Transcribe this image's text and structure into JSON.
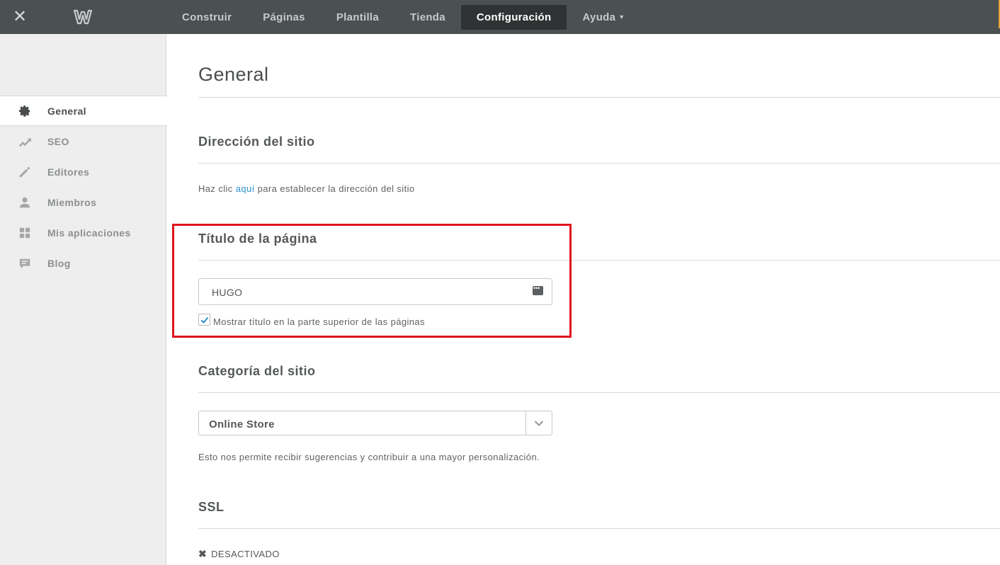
{
  "topbar": {
    "close_icon": "close-icon",
    "logo_icon": "weebly-logo-icon",
    "nav": [
      {
        "label": "Construir",
        "active": false
      },
      {
        "label": "Páginas",
        "active": false
      },
      {
        "label": "Plantilla",
        "active": false
      },
      {
        "label": "Tienda",
        "active": false
      },
      {
        "label": "Configuración",
        "active": true
      },
      {
        "label": "Ayuda",
        "active": false,
        "has_caret": true
      }
    ]
  },
  "sidebar": {
    "items": [
      {
        "label": "General",
        "icon": "gear-icon",
        "active": true
      },
      {
        "label": "SEO",
        "icon": "trend-icon",
        "active": false
      },
      {
        "label": "Editores",
        "icon": "pencil-icon",
        "active": false
      },
      {
        "label": "Miembros",
        "icon": "person-icon",
        "active": false
      },
      {
        "label": "Mis aplicaciones",
        "icon": "apps-grid-icon",
        "active": false
      },
      {
        "label": "Blog",
        "icon": "comment-icon",
        "active": false
      }
    ]
  },
  "main": {
    "page_title": "General",
    "site_address": {
      "title": "Dirección del sitio",
      "text_before": "Haz clic ",
      "link": "aquí",
      "text_after": " para establecer la dirección del sitio"
    },
    "page_title_section": {
      "title": "Título de la página",
      "input_value": "HUGO",
      "checkbox_label": "Mostrar título en la parte superior de las páginas",
      "checkbox_checked": true
    },
    "site_category": {
      "title": "Categoría del sitio",
      "selected": "Online Store",
      "help": "Esto nos permite recibir sugerencias y contribuir a una mayor personalización."
    },
    "ssl": {
      "title": "SSL",
      "status": "DESACTIVADO"
    }
  },
  "colors": {
    "topbar_bg": "#4b5052",
    "nav_active_bg": "#2f3334",
    "link": "#2e8fd1",
    "highlight_border": "#e0141e",
    "checkbox_check": "#2e8fd1"
  }
}
